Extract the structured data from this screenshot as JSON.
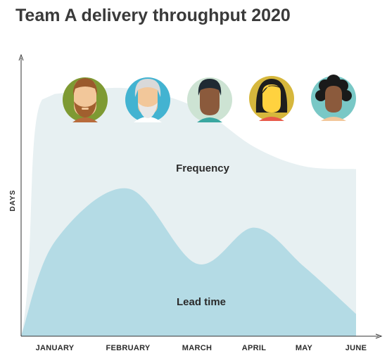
{
  "chart_data": {
    "type": "area",
    "title": "Team A delivery throughput 2020",
    "xlabel": "",
    "ylabel": "DAYS",
    "categories": [
      "JANUARY",
      "FEBRUARY",
      "MARCH",
      "APRIL",
      "MAY",
      "JUNE"
    ],
    "ylim": [
      0,
      100
    ],
    "grid": false,
    "series": [
      {
        "name": "Frequency",
        "color": "#e7f0f2",
        "values": [
          87,
          89,
          82,
          68,
          61,
          60
        ]
      },
      {
        "name": "Lead time",
        "color": "#b4dbe5",
        "values": [
          34,
          53,
          26,
          39,
          25,
          8
        ]
      }
    ],
    "avatars": [
      {
        "icon": "bearded-man-avatar-icon",
        "bg": "#7e9a33"
      },
      {
        "icon": "older-man-avatar-icon",
        "bg": "#43b3d1"
      },
      {
        "icon": "man-avatar-icon",
        "bg": "#cde3d3"
      },
      {
        "icon": "woman-avatar-icon",
        "bg": "#d6b73c"
      },
      {
        "icon": "curly-hair-woman-avatar-icon",
        "bg": "#79c8c6"
      }
    ]
  }
}
